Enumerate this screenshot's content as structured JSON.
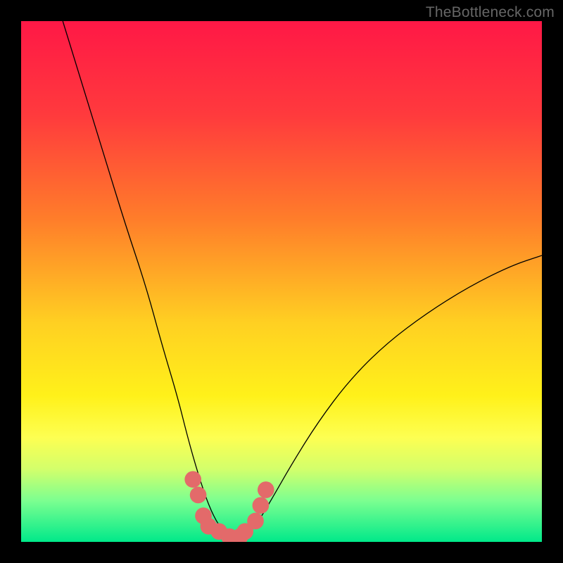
{
  "watermark": {
    "text": "TheBottleneck.com"
  },
  "chart_data": {
    "type": "line",
    "title": "",
    "xlabel": "",
    "ylabel": "",
    "xlim": [
      0,
      100
    ],
    "ylim": [
      0,
      100
    ],
    "gradient_stops": [
      {
        "offset": 0,
        "color": "#ff1846"
      },
      {
        "offset": 18,
        "color": "#ff3a3d"
      },
      {
        "offset": 38,
        "color": "#ff7d2a"
      },
      {
        "offset": 58,
        "color": "#ffd022"
      },
      {
        "offset": 72,
        "color": "#fff11a"
      },
      {
        "offset": 80,
        "color": "#fdff52"
      },
      {
        "offset": 86,
        "color": "#d3ff6b"
      },
      {
        "offset": 92,
        "color": "#7dff90"
      },
      {
        "offset": 100,
        "color": "#00e98a"
      }
    ],
    "series": [
      {
        "name": "bottleneck-curve",
        "color": "#000000",
        "x": [
          8,
          12,
          16,
          20,
          24,
          27,
          30,
          32,
          34,
          36,
          38,
          40,
          42,
          45,
          48,
          52,
          57,
          63,
          70,
          78,
          86,
          94,
          100
        ],
        "y": [
          100,
          87,
          74,
          61,
          49,
          38,
          28,
          20,
          13,
          7,
          3,
          1,
          1,
          3,
          8,
          15,
          23,
          31,
          38,
          44,
          49,
          53,
          55
        ]
      }
    ],
    "markers": {
      "name": "target-cluster",
      "color": "#e36a6a",
      "radius": 1.6,
      "points": [
        {
          "x": 33,
          "y": 12
        },
        {
          "x": 34,
          "y": 9
        },
        {
          "x": 35,
          "y": 5
        },
        {
          "x": 36,
          "y": 3
        },
        {
          "x": 38,
          "y": 2
        },
        {
          "x": 40,
          "y": 1
        },
        {
          "x": 42,
          "y": 1
        },
        {
          "x": 43,
          "y": 2
        },
        {
          "x": 45,
          "y": 4
        },
        {
          "x": 46,
          "y": 7
        },
        {
          "x": 47,
          "y": 10
        }
      ]
    }
  }
}
